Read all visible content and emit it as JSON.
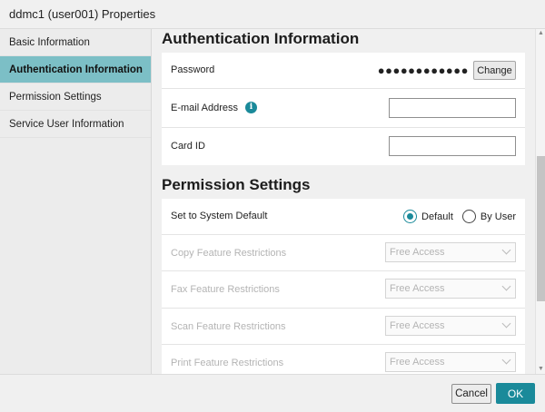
{
  "window": {
    "title": "ddmc1 (user001) Properties"
  },
  "sidebar": {
    "items": [
      {
        "label": "Basic Information"
      },
      {
        "label": "Authentication Information"
      },
      {
        "label": "Permission Settings"
      },
      {
        "label": "Service User Information"
      }
    ]
  },
  "auth": {
    "title": "Authentication Information",
    "password_label": "Password",
    "password_mask": "●●●●●●●●●●●●",
    "change_label": "Change",
    "email_label": "E-mail Address",
    "email_value": "",
    "info_icon": "info-icon",
    "info_glyph": "i",
    "cardid_label": "Card ID",
    "cardid_value": ""
  },
  "permissions": {
    "title": "Permission Settings",
    "system_default_label": "Set to System Default",
    "option_default": "Default",
    "option_byuser": "By User",
    "selected": "Default",
    "rows": [
      {
        "label": "Copy Feature Restrictions",
        "value": "Free Access"
      },
      {
        "label": "Fax Feature Restrictions",
        "value": "Free Access"
      },
      {
        "label": "Scan Feature Restrictions",
        "value": "Free Access"
      },
      {
        "label": "Print Feature Restrictions",
        "value": "Free Access"
      }
    ]
  },
  "footer": {
    "cancel_label": "Cancel",
    "ok_label": "OK"
  },
  "colors": {
    "accent": "#1a8a9a",
    "active_nav": "#7cbfc6"
  }
}
